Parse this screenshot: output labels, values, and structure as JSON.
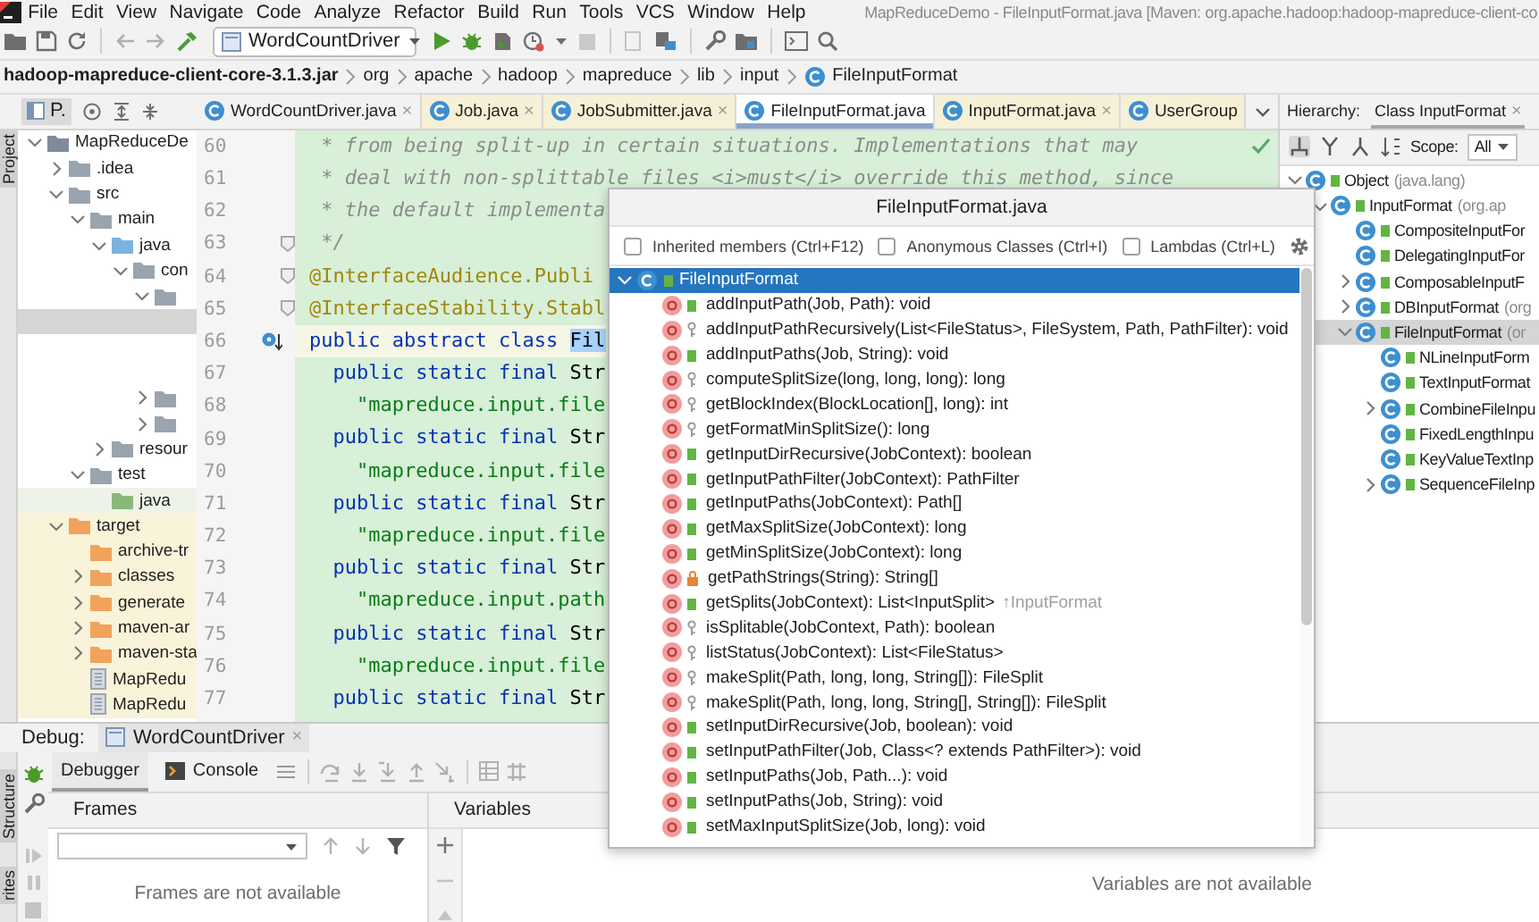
{
  "menubar": {
    "items": [
      "File",
      "Edit",
      "View",
      "Navigate",
      "Code",
      "Analyze",
      "Refactor",
      "Build",
      "Run",
      "Tools",
      "VCS",
      "Window",
      "Help"
    ],
    "title": "MapReduceDemo - FileInputFormat.java [Maven: org.apache.hadoop:hadoop-mapreduce-client-co"
  },
  "toolbar": {
    "run_config": "WordCountDriver"
  },
  "breadcrumb": [
    {
      "text": "hadoop-mapreduce-client-core-3.1.3.jar",
      "kind": "jar"
    },
    {
      "text": "org",
      "kind": "package"
    },
    {
      "text": "apache",
      "kind": "package"
    },
    {
      "text": "hadoop",
      "kind": "package"
    },
    {
      "text": "mapreduce",
      "kind": "package"
    },
    {
      "text": "lib",
      "kind": "package"
    },
    {
      "text": "input",
      "kind": "package"
    },
    {
      "text": "FileInputFormat",
      "kind": "class"
    }
  ],
  "project": {
    "side_label": "Project",
    "title": "P.",
    "tree": [
      {
        "label": "MapReduceDe",
        "kind": "module",
        "expanded": true,
        "selected": false,
        "excluded": false,
        "children": [
          {
            "label": ".idea",
            "kind": "folder",
            "expanded": false,
            "selected": false,
            "excluded": false
          },
          {
            "label": "src",
            "kind": "folder",
            "expanded": true,
            "selected": false,
            "excluded": false,
            "children": [
              {
                "label": "main",
                "kind": "folder",
                "expanded": true,
                "selected": false,
                "excluded": false,
                "children": [
                  {
                    "label": "java",
                    "kind": "source",
                    "expanded": true,
                    "selected": false,
                    "excluded": false,
                    "children": [
                      {
                        "label": "con",
                        "kind": "package",
                        "expanded": true,
                        "selected": false,
                        "excluded": false,
                        "children": [
                          {
                            "kind": "package",
                            "expanded": true,
                            "selected": false,
                            "excluded": false,
                            "children": [
                              {
                                "kind": "blank",
                                "selected": true
                              }
                            ]
                          },
                          {
                            "kind": "package",
                            "expanded": false,
                            "selected": false,
                            "excluded": false
                          },
                          {
                            "kind": "package",
                            "expanded": false,
                            "selected": false,
                            "excluded": false
                          }
                        ]
                      }
                    ]
                  },
                  {
                    "label": "resour",
                    "kind": "resources",
                    "expanded": false,
                    "selected": false,
                    "excluded": false
                  }
                ]
              },
              {
                "label": "test",
                "kind": "folder",
                "expanded": true,
                "selected": false,
                "excluded": false,
                "children": [
                  {
                    "label": "java",
                    "kind": "test-source",
                    "selected": false,
                    "excluded": false
                  }
                ]
              }
            ]
          },
          {
            "label": "target",
            "kind": "excluded-folder",
            "expanded": true,
            "selected": false,
            "excluded": true,
            "children": [
              {
                "label": "archive-tr",
                "kind": "excluded-folder",
                "selected": false,
                "excluded": true
              },
              {
                "label": "classes",
                "kind": "excluded-folder",
                "expanded": false,
                "selected": false,
                "excluded": true
              },
              {
                "label": "generate",
                "kind": "excluded-folder",
                "expanded": false,
                "selected": false,
                "excluded": true
              },
              {
                "label": "maven-ar",
                "kind": "excluded-folder",
                "expanded": false,
                "selected": false,
                "excluded": true
              },
              {
                "label": "maven-sta",
                "kind": "excluded-folder",
                "expanded": false,
                "selected": false,
                "excluded": true
              },
              {
                "label": "MapRedu",
                "kind": "file",
                "selected": false,
                "excluded": true
              },
              {
                "label": "MapRedu",
                "kind": "file",
                "selected": false,
                "excluded": true
              }
            ]
          }
        ]
      }
    ]
  },
  "editor_tabs": [
    {
      "label": "WordCountDriver.java",
      "kind": "project",
      "selected": false,
      "close": "×"
    },
    {
      "label": "Job.java",
      "kind": "library",
      "selected": false,
      "close": "×"
    },
    {
      "label": "JobSubmitter.java",
      "kind": "library",
      "selected": false,
      "close": "×"
    },
    {
      "label": "FileInputFormat.java",
      "kind": "library",
      "selected": true
    },
    {
      "label": "InputFormat.java",
      "kind": "library",
      "selected": false,
      "close": "×"
    },
    {
      "label": "UserGroup",
      "kind": "library",
      "selected": false
    }
  ],
  "editor": {
    "lines": [
      {
        "number": "60",
        "kind": "plain",
        "current": false,
        "tokens": [
          {
            "kind": "comment",
            "text": " * from being split-up in certain situations. Implementations that may"
          }
        ]
      },
      {
        "number": "61",
        "kind": "plain",
        "current": false,
        "tokens": [
          {
            "kind": "comment",
            "text": " * deal with non-splittable files <i>must</i> override this method, since"
          }
        ]
      },
      {
        "number": "62",
        "kind": "plain",
        "current": false,
        "tokens": [
          {
            "kind": "comment",
            "text": " * the default implementa"
          }
        ]
      },
      {
        "number": "63",
        "kind": "fold",
        "current": false,
        "tokens": [
          {
            "kind": "comment",
            "text": " */"
          }
        ]
      },
      {
        "number": "64",
        "kind": "fold",
        "current": false,
        "tokens": [
          {
            "kind": "annotation",
            "text": "@InterfaceAudience.Publi"
          }
        ]
      },
      {
        "number": "65",
        "kind": "fold",
        "current": false,
        "tokens": [
          {
            "kind": "annotation",
            "text": "@InterfaceStability.Stabl"
          }
        ]
      },
      {
        "number": "66",
        "kind": "implemented",
        "current": true,
        "tokens": [
          {
            "kind": "keyword",
            "text": "public abstract class "
          },
          {
            "kind": "selection",
            "text": "Fil"
          }
        ]
      },
      {
        "number": "67",
        "kind": "plain",
        "current": false,
        "tokens": [
          {
            "kind": "keyword",
            "text": "  public static final "
          },
          {
            "kind": "plain",
            "text": "Str"
          }
        ]
      },
      {
        "number": "68",
        "kind": "plain",
        "current": false,
        "tokens": [
          {
            "kind": "string",
            "text": "    \"mapreduce.input.file"
          }
        ]
      },
      {
        "number": "69",
        "kind": "plain",
        "current": false,
        "tokens": [
          {
            "kind": "keyword",
            "text": "  public static final "
          },
          {
            "kind": "plain",
            "text": "Str"
          }
        ]
      },
      {
        "number": "70",
        "kind": "plain",
        "current": false,
        "tokens": [
          {
            "kind": "string",
            "text": "    \"mapreduce.input.file"
          }
        ]
      },
      {
        "number": "71",
        "kind": "plain",
        "current": false,
        "tokens": [
          {
            "kind": "keyword",
            "text": "  public static final "
          },
          {
            "kind": "plain",
            "text": "Str"
          }
        ]
      },
      {
        "number": "72",
        "kind": "plain",
        "current": false,
        "tokens": [
          {
            "kind": "string",
            "text": "    \"mapreduce.input.file"
          }
        ]
      },
      {
        "number": "73",
        "kind": "plain",
        "current": false,
        "tokens": [
          {
            "kind": "keyword",
            "text": "  public static final "
          },
          {
            "kind": "plain",
            "text": "Str"
          }
        ]
      },
      {
        "number": "74",
        "kind": "plain",
        "current": false,
        "tokens": [
          {
            "kind": "string",
            "text": "    \"mapreduce.input.path"
          }
        ]
      },
      {
        "number": "75",
        "kind": "plain",
        "current": false,
        "tokens": [
          {
            "kind": "keyword",
            "text": "  public static final "
          },
          {
            "kind": "plain",
            "text": "Str"
          }
        ]
      },
      {
        "number": "76",
        "kind": "plain",
        "current": false,
        "tokens": [
          {
            "kind": "string",
            "text": "    \"mapreduce.input.file"
          }
        ]
      },
      {
        "number": "77",
        "kind": "plain",
        "current": false,
        "tokens": [
          {
            "kind": "keyword",
            "text": "  public static final "
          },
          {
            "kind": "plain",
            "text": "Str"
          }
        ]
      }
    ]
  },
  "hierarchy": {
    "label": "Hierarchy:",
    "tab": {
      "label": "Class InputFormat",
      "close": "×"
    },
    "scope_label": "Scope:",
    "scope": "All",
    "tree": [
      {
        "label": "Object",
        "detail": "(java.lang)",
        "expanded": true,
        "selected": false,
        "children": [
          {
            "label": "InputFormat",
            "detail": "(org.ap",
            "expanded": true,
            "selected": false,
            "children": [
              {
                "label": "CompositeInputFor",
                "selected": false
              },
              {
                "label": "DelegatingInputFor",
                "selected": false
              },
              {
                "label": "ComposableInputF",
                "expanded": false,
                "selected": false
              },
              {
                "label": "DBInputFormat",
                "detail": "(org",
                "expanded": false,
                "selected": false
              },
              {
                "label": "FileInputFormat",
                "detail": "(or",
                "expanded": true,
                "selected": true,
                "children": [
                  {
                    "label": "NLineInputForm",
                    "selected": false
                  },
                  {
                    "label": "TextInputFormat",
                    "selected": false
                  },
                  {
                    "label": "CombineFileInpu",
                    "expanded": false,
                    "selected": false
                  },
                  {
                    "label": "FixedLengthInpu",
                    "selected": false
                  },
                  {
                    "label": "KeyValueTextInp",
                    "selected": false
                  },
                  {
                    "label": "SequenceFileInp",
                    "expanded": false,
                    "selected": false
                  }
                ]
              }
            ]
          }
        ]
      }
    ]
  },
  "structure_popup": {
    "title": "FileInputFormat.java",
    "options": [
      {
        "label": "Inherited members (Ctrl+F12)",
        "checked": false
      },
      {
        "label": "Anonymous Classes (Ctrl+I)",
        "checked": false
      },
      {
        "label": "Lambdas (Ctrl+L)",
        "checked": false
      }
    ],
    "root": {
      "label": "FileInputFormat",
      "expanded": true,
      "selected": true,
      "members": [
        {
          "name": "addInputPath(Job, Path): void",
          "kind": "public",
          "selected": false
        },
        {
          "name": "addInputPathRecursively(List<FileStatus>, FileSystem, Path, PathFilter): void",
          "kind": "protected",
          "selected": false
        },
        {
          "name": "addInputPaths(Job, String): void",
          "kind": "public",
          "selected": false
        },
        {
          "name": "computeSplitSize(long, long, long): long",
          "kind": "protected",
          "selected": false
        },
        {
          "name": "getBlockIndex(BlockLocation[], long): int",
          "kind": "protected",
          "selected": false
        },
        {
          "name": "getFormatMinSplitSize(): long",
          "kind": "protected",
          "selected": false
        },
        {
          "name": "getInputDirRecursive(JobContext): boolean",
          "kind": "public",
          "selected": false
        },
        {
          "name": "getInputPathFilter(JobContext): PathFilter",
          "kind": "public",
          "selected": false
        },
        {
          "name": "getInputPaths(JobContext): Path[]",
          "kind": "public",
          "selected": false
        },
        {
          "name": "getMaxSplitSize(JobContext): long",
          "kind": "public",
          "selected": false
        },
        {
          "name": "getMinSplitSize(JobContext): long",
          "kind": "public",
          "selected": false
        },
        {
          "name": "getPathStrings(String): String[]",
          "kind": "private",
          "selected": false
        },
        {
          "name": "getSplits(JobContext): List<InputSplit>",
          "kind": "public",
          "selected": false,
          "origin": "↑InputFormat"
        },
        {
          "name": "isSplitable(JobContext, Path): boolean",
          "kind": "protected",
          "selected": false
        },
        {
          "name": "listStatus(JobContext): List<FileStatus>",
          "kind": "protected",
          "selected": false
        },
        {
          "name": "makeSplit(Path, long, long, String[]): FileSplit",
          "kind": "protected",
          "selected": false
        },
        {
          "name": "makeSplit(Path, long, long, String[], String[]): FileSplit",
          "kind": "protected",
          "selected": false
        },
        {
          "name": "setInputDirRecursive(Job, boolean): void",
          "kind": "public",
          "selected": false
        },
        {
          "name": "setInputPathFilter(Job, Class<? extends PathFilter>): void",
          "kind": "public",
          "selected": false
        },
        {
          "name": "setInputPaths(Job, Path...): void",
          "kind": "public",
          "selected": false
        },
        {
          "name": "setInputPaths(Job, String): void",
          "kind": "public",
          "selected": false
        },
        {
          "name": "setMaxInputSplitSize(Job, long): void",
          "kind": "public",
          "selected": false
        }
      ]
    }
  },
  "debug": {
    "label": "Debug:",
    "session": {
      "label": "WordCountDriver",
      "close": "×"
    },
    "tabs": [
      {
        "label": "Debugger",
        "selected": true
      },
      {
        "label": "Console",
        "selected": false
      }
    ],
    "frames": {
      "title": "Frames",
      "empty": "Frames are not available"
    },
    "variables": {
      "title": "Variables",
      "empty": "Variables are not available"
    },
    "side_labels": [
      "Structure",
      "rites"
    ]
  }
}
